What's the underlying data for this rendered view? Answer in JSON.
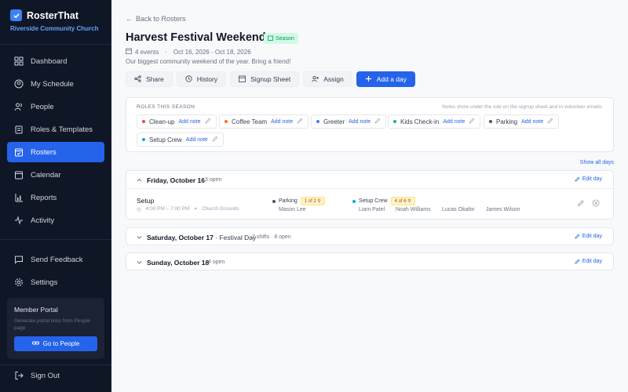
{
  "brand": {
    "name": "RosterThat",
    "org": "Riverside Community Church"
  },
  "nav": {
    "items": [
      {
        "label": "Dashboard",
        "icon": "dashboard-icon"
      },
      {
        "label": "My Schedule",
        "icon": "user-circle-icon"
      },
      {
        "label": "People",
        "icon": "people-icon"
      },
      {
        "label": "Roles & Templates",
        "icon": "clipboard-icon"
      },
      {
        "label": "Rosters",
        "icon": "calendar-check-icon",
        "active": true
      },
      {
        "label": "Calendar",
        "icon": "calendar-icon"
      },
      {
        "label": "Reports",
        "icon": "chart-icon"
      },
      {
        "label": "Activity",
        "icon": "activity-icon"
      }
    ],
    "bottom": [
      {
        "label": "Send Feedback",
        "icon": "message-icon"
      },
      {
        "label": "Settings",
        "icon": "gear-icon"
      }
    ],
    "sign_out": "Sign Out"
  },
  "portal": {
    "title": "Member Portal",
    "desc": "Generate portal links from People page",
    "button": "Go to People"
  },
  "header": {
    "back": "Back to Rosters",
    "title": "Harvest Festival Weekend",
    "badge": "Season",
    "events": "4 events",
    "dates": "Oct 16, 2026 - Oct 18, 2026",
    "subtitle": "Our biggest community weekend of the year. Bring a friend!"
  },
  "toolbar": {
    "share": "Share",
    "history": "History",
    "signup": "Signup Sheet",
    "assign": "Assign",
    "add_day": "Add a day"
  },
  "roles": {
    "heading": "ROLES THIS SEASON",
    "note": "Notes show under the role on the signup sheet and in volunteer emails.",
    "add_note": "Add note",
    "items": [
      {
        "label": "Clean-up",
        "color": "#ef4444"
      },
      {
        "label": "Coffee Team",
        "color": "#f97316"
      },
      {
        "label": "Greeter",
        "color": "#3b82f6"
      },
      {
        "label": "Kids Check-in",
        "color": "#10b981"
      },
      {
        "label": "Parking",
        "color": "#4b5563"
      },
      {
        "label": "Setup Crew",
        "color": "#0ea5e9"
      }
    ]
  },
  "show_all": "Show all days",
  "edit_day": "Edit day",
  "days": {
    "fri": {
      "title": "Friday, October 16",
      "open": "3 open",
      "shift": {
        "name": "Setup",
        "time": "4:00 PM – 7:00 PM",
        "location": "Church Grounds",
        "parking": {
          "label": "Parking",
          "fill": "1 of 2",
          "volunteers": [
            "Mason Lee"
          ]
        },
        "setup": {
          "label": "Setup Crew",
          "fill": "4 of 6",
          "volunteers": [
            "Liam Patel",
            "Noah Williams",
            "Lucas Okafor",
            "James Wilson"
          ]
        }
      }
    },
    "sat": {
      "title": "Saturday, October 17",
      "subtitle": "· Festival Day",
      "open": "2 shifts · 8 open"
    },
    "sun": {
      "title": "Sunday, October 18",
      "open": "4 open"
    }
  }
}
